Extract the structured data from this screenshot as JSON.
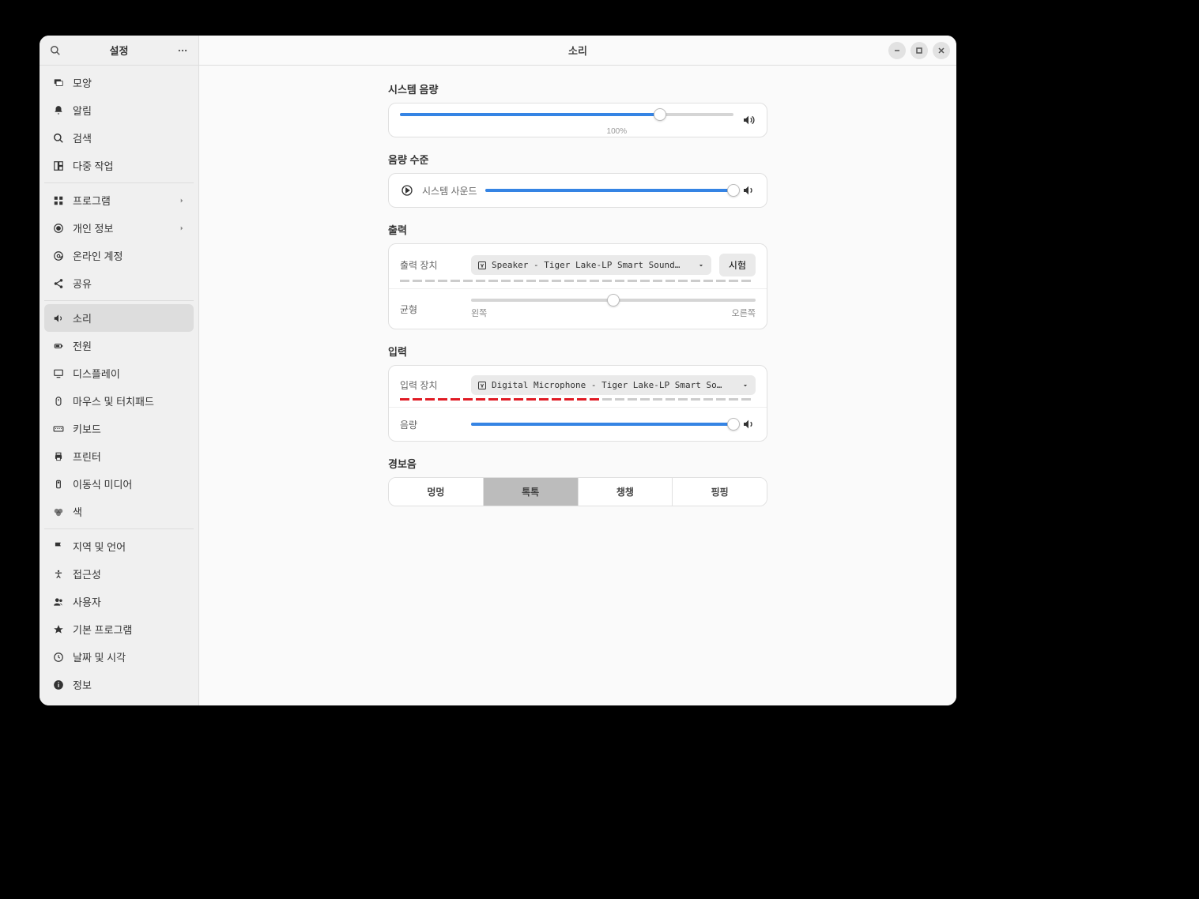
{
  "header": {
    "sidebar_title": "설정",
    "main_title": "소리"
  },
  "sidebar": {
    "items": [
      {
        "label": "모양",
        "icon": "appearance"
      },
      {
        "label": "알림",
        "icon": "bell"
      },
      {
        "label": "검색",
        "icon": "search"
      },
      {
        "label": "다중 작업",
        "icon": "multi"
      },
      {
        "divider": true
      },
      {
        "label": "프로그램",
        "icon": "apps",
        "chevron": true
      },
      {
        "label": "개인 정보",
        "icon": "privacy",
        "chevron": true
      },
      {
        "label": "온라인 계정",
        "icon": "at"
      },
      {
        "label": "공유",
        "icon": "share"
      },
      {
        "divider": true
      },
      {
        "label": "소리",
        "icon": "speaker",
        "active": true
      },
      {
        "label": "전원",
        "icon": "power"
      },
      {
        "label": "디스플레이",
        "icon": "display"
      },
      {
        "label": "마우스 및 터치패드",
        "icon": "mouse"
      },
      {
        "label": "키보드",
        "icon": "keyboard"
      },
      {
        "label": "프린터",
        "icon": "printer"
      },
      {
        "label": "이동식 미디어",
        "icon": "removable"
      },
      {
        "label": "색",
        "icon": "color"
      },
      {
        "divider": true
      },
      {
        "label": "지역 및 언어",
        "icon": "flag"
      },
      {
        "label": "접근성",
        "icon": "accessibility"
      },
      {
        "label": "사용자",
        "icon": "users"
      },
      {
        "label": "기본 프로그램",
        "icon": "star"
      },
      {
        "label": "날짜 및 시각",
        "icon": "clock"
      },
      {
        "label": "정보",
        "icon": "info"
      }
    ]
  },
  "sound": {
    "system_volume": {
      "title": "시스템 음량",
      "value": 100,
      "tick_label": "100%"
    },
    "volume_levels": {
      "title": "음량 수준",
      "system_sound_label": "시스템 사운드",
      "value": 100
    },
    "output": {
      "title": "출력",
      "device_label": "출력 장치",
      "device_value": "Speaker - Tiger Lake-LP Smart Sound…",
      "test_label": "시험",
      "balance_label": "균형",
      "balance_left": "왼쪽",
      "balance_right": "오른쪽",
      "balance_value": 50,
      "meter_total": 28,
      "meter_active": 0
    },
    "input": {
      "title": "입력",
      "device_label": "입력 장치",
      "device_value": "Digital Microphone - Tiger Lake-LP Smart So…",
      "volume_label": "음량",
      "volume_value": 100,
      "meter_total": 28,
      "meter_active": 16
    },
    "alert": {
      "title": "경보음",
      "options": [
        "멍멍",
        "톡톡",
        "챙챙",
        "핑핑"
      ],
      "selected": 1
    }
  }
}
